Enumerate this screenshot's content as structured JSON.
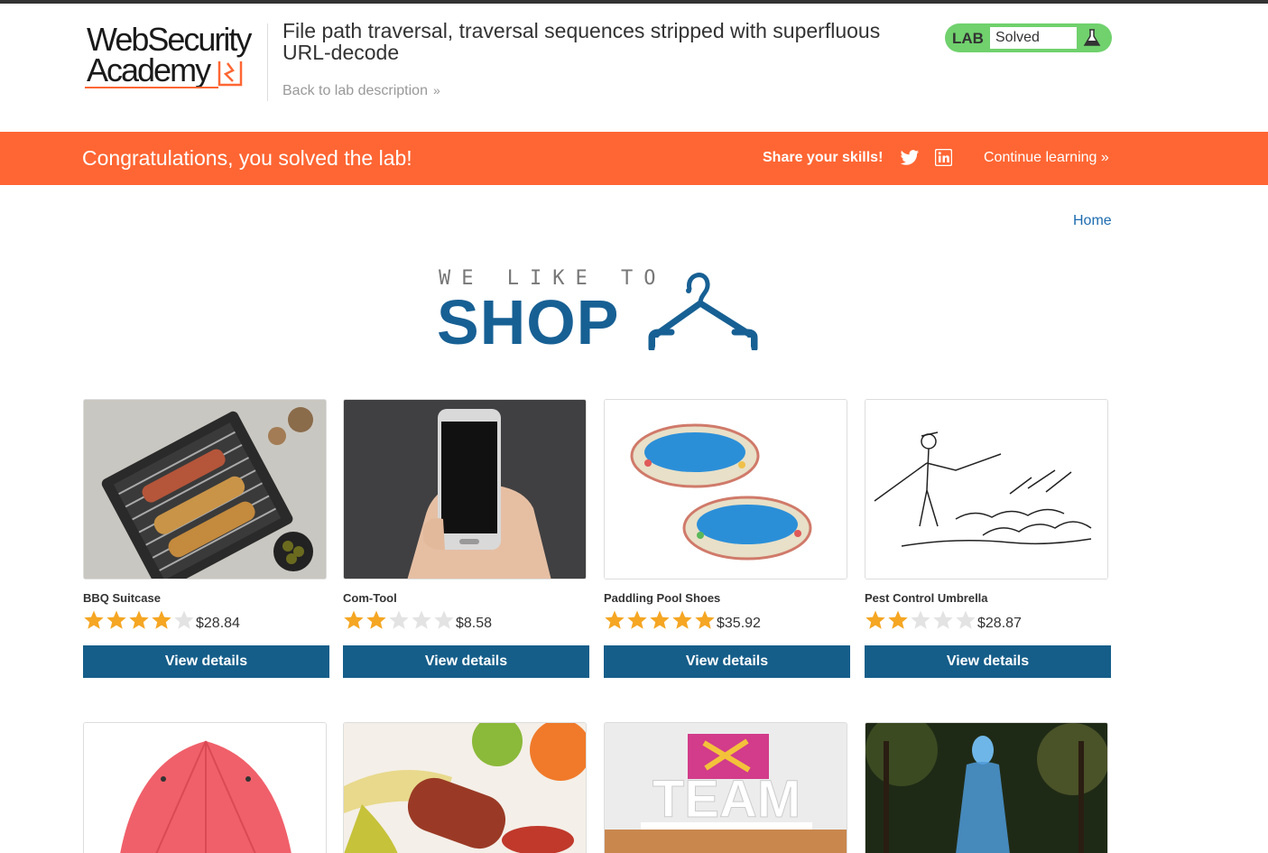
{
  "header": {
    "logo_line1": "WebSecurity",
    "logo_line2": "Academy",
    "lab_title": "File path traversal, traversal sequences stripped with superfluous URL-decode",
    "back_link": "Back to lab description",
    "lab_badge": "LAB",
    "lab_status": "Solved"
  },
  "banner": {
    "congrats": "Congratulations, you solved the lab!",
    "share": "Share your skills!",
    "continue": "Continue learning",
    "social_icons": [
      "twitter-icon",
      "linkedin-icon"
    ]
  },
  "nav": {
    "home": "Home"
  },
  "hero": {
    "tagline": "WE LIKE TO",
    "title": "SHOP"
  },
  "colors": {
    "accent": "#ff6633",
    "brand_blue": "#155e8a",
    "lab_green": "#70d16d",
    "star": "#f5a623"
  },
  "products": [
    {
      "name": "BBQ Suitcase",
      "rating": 4,
      "price": "$28.84",
      "button": "View details",
      "image": "bbq-grill"
    },
    {
      "name": "Com-Tool",
      "rating": 2,
      "price": "$8.58",
      "button": "View details",
      "image": "smartphone"
    },
    {
      "name": "Paddling Pool Shoes",
      "rating": 5,
      "price": "$35.92",
      "button": "View details",
      "image": "paddling-pools"
    },
    {
      "name": "Pest Control Umbrella",
      "rating": 2,
      "price": "$28.87",
      "button": "View details",
      "image": "umbrella-sketch"
    },
    {
      "image": "red-umbrella"
    },
    {
      "image": "fruit-and-sausage"
    },
    {
      "image": "team-letters"
    },
    {
      "image": "hologram-woman"
    }
  ]
}
